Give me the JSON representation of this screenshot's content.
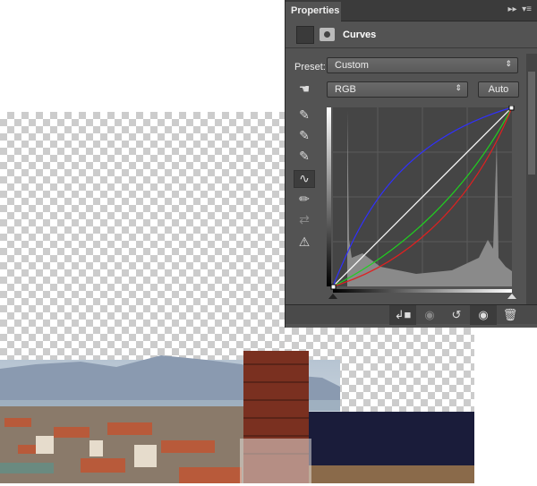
{
  "panel": {
    "tab": "Properties",
    "title": "Curves",
    "preset_label": "Preset:",
    "preset_value": "Custom",
    "channel_value": "RGB",
    "auto_label": "Auto"
  },
  "icons": {
    "tab_menu": "panel-menu-icon",
    "collapse": "double-arrow-icon"
  },
  "curves": {
    "channels": [
      "RGB",
      "Red",
      "Green",
      "Blue"
    ],
    "colors": {
      "rgb": "#ffffff",
      "red": "#e02020",
      "green": "#20d020",
      "blue": "#3030ff"
    }
  }
}
